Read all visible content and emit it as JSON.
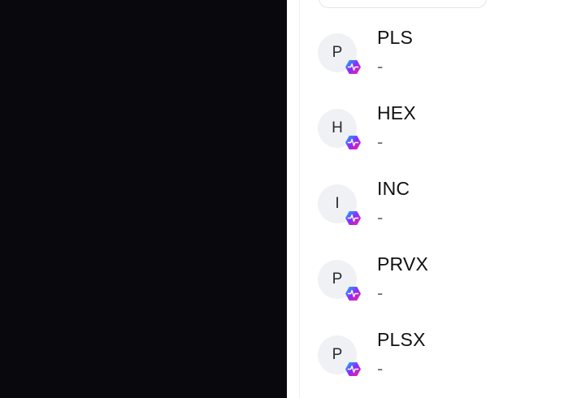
{
  "token_list": {
    "items": [
      {
        "avatar_letter": "P",
        "symbol": "PLS",
        "balance": "-",
        "chain_icon": "pulsechain-icon"
      },
      {
        "avatar_letter": "H",
        "symbol": "HEX",
        "balance": "-",
        "chain_icon": "pulsechain-icon"
      },
      {
        "avatar_letter": "I",
        "symbol": "INC",
        "balance": "-",
        "chain_icon": "pulsechain-icon"
      },
      {
        "avatar_letter": "P",
        "symbol": "PRVX",
        "balance": "-",
        "chain_icon": "pulsechain-icon"
      },
      {
        "avatar_letter": "P",
        "symbol": "PLSX",
        "balance": "-",
        "chain_icon": "pulsechain-icon"
      }
    ]
  },
  "colors": {
    "backdrop": "#09090d",
    "panel": "#ffffff",
    "avatar_bg": "#f0f1f5",
    "chain_gradient_start": "#00c2ff",
    "chain_gradient_mid": "#8a2cff",
    "chain_gradient_end": "#ff1f8f"
  }
}
